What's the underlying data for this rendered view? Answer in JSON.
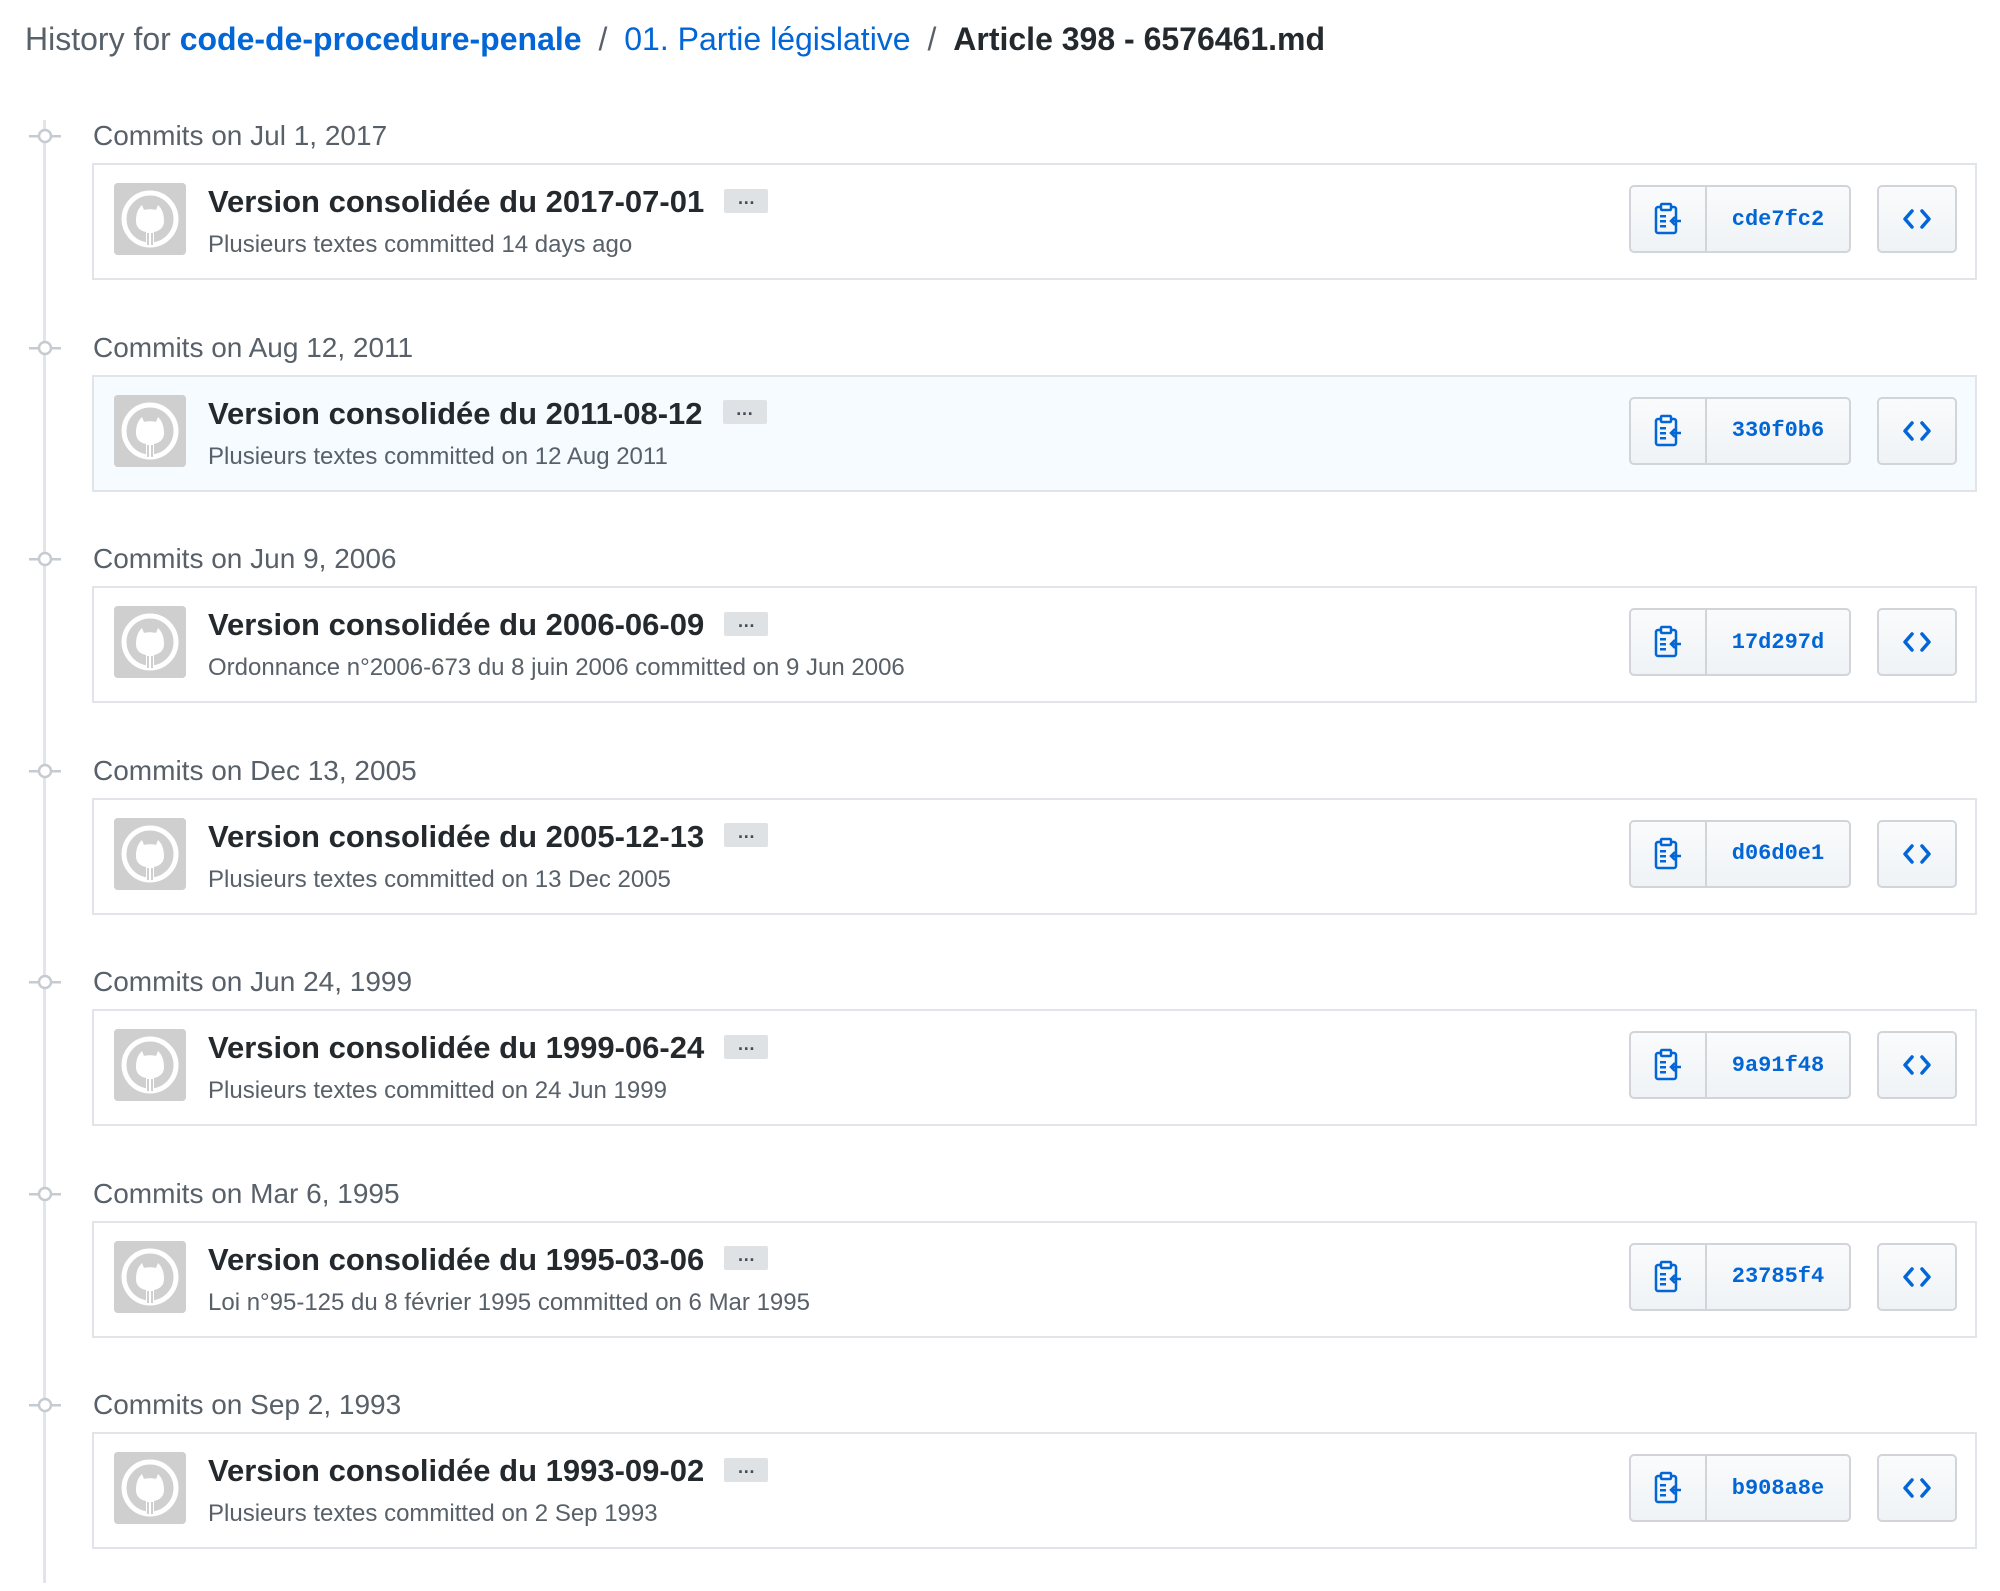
{
  "breadcrumb": {
    "prefix": "History for",
    "repo": "code-de-procedure-penale",
    "separator": "/",
    "folder": "01. Partie législative",
    "file": "Article 398 - 6576461.md"
  },
  "colors": {
    "link": "#0366d6",
    "muted": "#586069",
    "border": "#e1e4e8",
    "highlight": "#f6fbff"
  },
  "icons": {
    "avatar": "github-octocat-icon",
    "copy": "clipboard-icon",
    "browse": "code-icon",
    "node": "git-commit-icon"
  },
  "ellipsis_label": "…",
  "groups": [
    {
      "header": "Commits on Jul 1, 2017",
      "title": "Version consolidée du 2017-07-01",
      "meta": "Plusieurs textes committed 14 days ago",
      "sha": "cde7fc2",
      "highlight": false
    },
    {
      "header": "Commits on Aug 12, 2011",
      "title": "Version consolidée du 2011-08-12",
      "meta": "Plusieurs textes committed on 12 Aug 2011",
      "sha": "330f0b6",
      "highlight": true
    },
    {
      "header": "Commits on Jun 9, 2006",
      "title": "Version consolidée du 2006-06-09",
      "meta": "Ordonnance n°2006-673 du 8 juin 2006 committed on 9 Jun 2006",
      "sha": "17d297d",
      "highlight": false
    },
    {
      "header": "Commits on Dec 13, 2005",
      "title": "Version consolidée du 2005-12-13",
      "meta": "Plusieurs textes committed on 13 Dec 2005",
      "sha": "d06d0e1",
      "highlight": false
    },
    {
      "header": "Commits on Jun 24, 1999",
      "title": "Version consolidée du 1999-06-24",
      "meta": "Plusieurs textes committed on 24 Jun 1999",
      "sha": "9a91f48",
      "highlight": false
    },
    {
      "header": "Commits on Mar 6, 1995",
      "title": "Version consolidée du 1995-03-06",
      "meta": "Loi n°95-125 du 8 février 1995 committed on 6 Mar 1995",
      "sha": "23785f4",
      "highlight": false
    },
    {
      "header": "Commits on Sep 2, 1993",
      "title": "Version consolidée du 1993-09-02",
      "meta": "Plusieurs textes committed on 2 Sep 1993",
      "sha": "b908a8e",
      "highlight": false
    }
  ]
}
